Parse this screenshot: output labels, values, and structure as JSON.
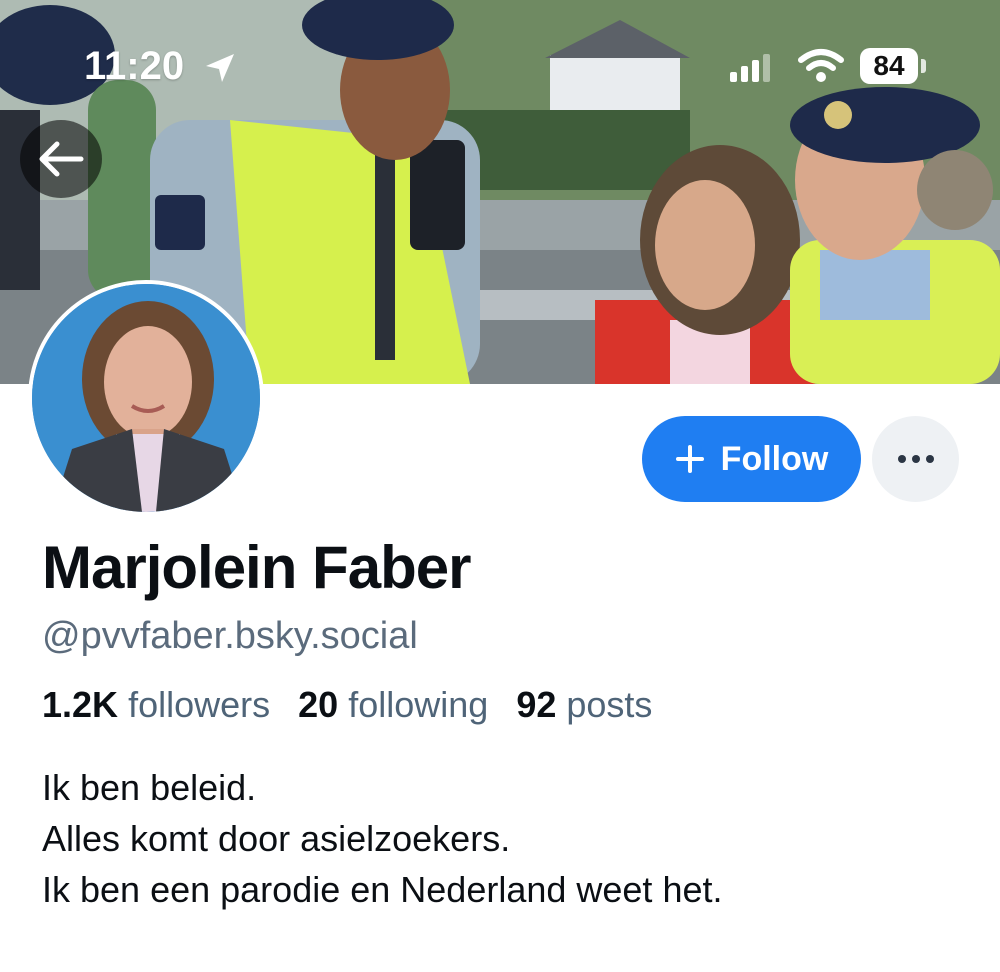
{
  "status_bar": {
    "time": "11:20",
    "battery": "84",
    "icons": [
      "location-arrow-icon",
      "signal-icon",
      "wifi-icon",
      "battery-icon"
    ]
  },
  "navigation": {
    "back_icon": "arrow-left-icon"
  },
  "profile": {
    "display_name": "Marjolein Faber",
    "handle": "@pvvfaber.bsky.social",
    "stats": {
      "followers_count": "1.2K",
      "followers_label": "followers",
      "following_count": "20",
      "following_label": "following",
      "posts_count": "92",
      "posts_label": "posts"
    },
    "bio": [
      "Ik ben beleid.",
      "Alles komt door asielzoekers.",
      "Ik ben een parodie en Nederland weet het."
    ]
  },
  "actions": {
    "follow_label": "Follow",
    "follow_icon": "plus-icon",
    "more_icon": "ellipsis-icon"
  },
  "colors": {
    "accent": "#1f7ef2",
    "text": "#0b0f14",
    "muted": "#5b6b7c",
    "avatar_bg": "#3a8fd0"
  }
}
